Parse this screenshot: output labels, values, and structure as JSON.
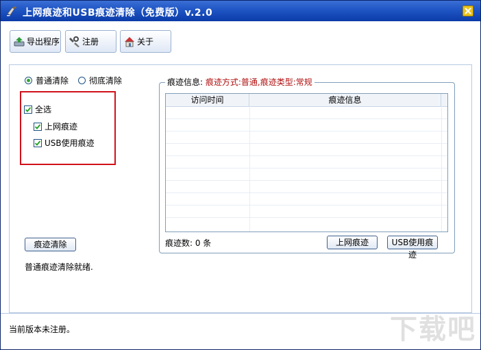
{
  "window": {
    "title": "上网痕迹和USB痕迹清除（免费版）v.2.0"
  },
  "toolbar": {
    "export_label": "导出程序",
    "register_label": "注册",
    "about_label": "关于"
  },
  "mode": {
    "normal_label": "普通清除",
    "thorough_label": "彻底清除",
    "selected": "normal"
  },
  "options": {
    "select_all": {
      "label": "全选",
      "checked": true
    },
    "web_traces": {
      "label": "上网痕迹",
      "checked": true
    },
    "usb_traces": {
      "label": "USB使用痕迹",
      "checked": true
    }
  },
  "actions": {
    "clear_label": "痕迹清除",
    "status": "普通痕迹清除就绪."
  },
  "trace_panel": {
    "legend_prefix": "痕迹信息:",
    "legend_detail": "痕迹方式:普通,痕迹类型:常规",
    "columns": [
      "访问时间",
      "痕迹信息"
    ],
    "count_label": "痕迹数: 0 条",
    "web_button": "上网痕迹",
    "usb_button": "USB使用痕迹"
  },
  "footer": {
    "text": "当前版本未注册。"
  },
  "watermark": {
    "text": "下载吧"
  },
  "colors": {
    "titlebar": "#1f55c4",
    "highlight_box": "#d0101a",
    "legend_detail": "#b01010"
  }
}
